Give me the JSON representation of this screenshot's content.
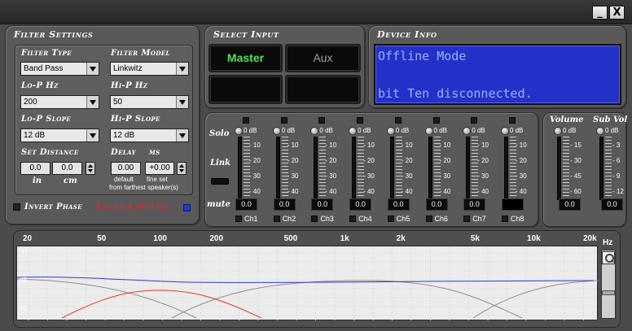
{
  "window": {
    "minimize_label": "_",
    "close_label": "X"
  },
  "filter_settings": {
    "title": "Filter Settings",
    "filter_type": {
      "label": "Filter Type",
      "value": "Band Pass"
    },
    "filter_model": {
      "label": "Filter Model",
      "value": "Linkwitz"
    },
    "lo_p_hz": {
      "label": "Lo-P  Hz",
      "value": "200"
    },
    "hi_p_hz": {
      "label": "Hi-P  Hz",
      "value": "50"
    },
    "lo_p_slope": {
      "label": "Lo-P Slope",
      "value": "12 dB"
    },
    "hi_p_slope": {
      "label": "Hi-P Slope",
      "value": "12 dB"
    },
    "set_distance": {
      "label": "Set Distance",
      "in_value": "0.0",
      "cm_value": "0.0",
      "in_label": "in",
      "cm_label": "cm"
    },
    "delay": {
      "label": "Delay",
      "unit": "ms",
      "default_value": "0.00",
      "fine_value": "+0.00",
      "default_label": "default",
      "fine_label": "fine set",
      "note": "from farthest speaker(s)"
    },
    "invert_phase": "Invert Phase",
    "xover_link": "Xover L/R Link"
  },
  "select_input": {
    "title": "Select Input",
    "master": "Master",
    "aux": "Aux"
  },
  "device_info": {
    "title": "Device Info",
    "line1": "Offline Mode",
    "line2": "bit Ten disconnected."
  },
  "mixer": {
    "solo": "Solo",
    "link": "Link",
    "mute": "mute",
    "max_label": "0 dB",
    "scale": [
      "- 10",
      "- 20",
      "- 30",
      "- 40"
    ],
    "channels": [
      {
        "name": "Ch1",
        "value": "0.0"
      },
      {
        "name": "Ch2",
        "value": "0.0"
      },
      {
        "name": "Ch3",
        "value": "0.0"
      },
      {
        "name": "Ch4",
        "value": "0.0"
      },
      {
        "name": "Ch5",
        "value": "0.0"
      },
      {
        "name": "Ch6",
        "value": "0.0"
      },
      {
        "name": "Ch7",
        "value": "0.0"
      },
      {
        "name": "Ch8",
        "value": ""
      }
    ]
  },
  "volume": {
    "title": "Volume",
    "max_label": "0 dB",
    "scale": [
      "- 15",
      "- 30",
      "- 45",
      "- 60"
    ],
    "value": "0.0"
  },
  "sub_vol": {
    "title": "Sub Vol",
    "max_label": "0 dB",
    "scale": [
      "- 3",
      "- 6",
      "- 9",
      "- 12"
    ],
    "value": "0.0"
  },
  "graph": {
    "freq_labels": [
      "20",
      "50",
      "100",
      "200",
      "500",
      "1k",
      "2k",
      "5k",
      "10k",
      "20k"
    ],
    "hz_label": "Hz",
    "db_top": "12",
    "db_mid": "dB",
    "db_bottom": "-12",
    "response_color": "#2b3bd0",
    "filter_color": "#e03a2a",
    "other_color": "#8e8e8e"
  }
}
